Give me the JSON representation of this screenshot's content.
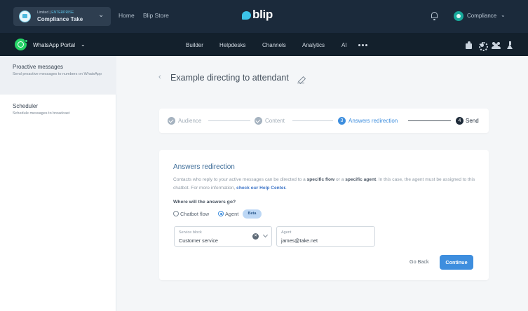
{
  "topbar": {
    "org_tier_prefix": "Limited | ",
    "org_tier_highlight": "ENTERPRISE",
    "org_name": "Compliance Take",
    "nav_home": "Home",
    "nav_store": "Blip Store",
    "brand": "blip",
    "account_name": "Compliance"
  },
  "subbar": {
    "portal_name": "WhatsApp Portal",
    "tabs": [
      "Builder",
      "Helpdesks",
      "Channels",
      "Analytics",
      "AI"
    ]
  },
  "sidebar": {
    "items": [
      {
        "title": "Proactive messages",
        "desc": "Send proactive messages to numbers on WhatsApp"
      },
      {
        "title": "Scheduler",
        "desc": "Schedule messages to broadcast"
      }
    ]
  },
  "main": {
    "page_title": "Example directing to attendant",
    "steps": [
      {
        "label": "Audience",
        "state": "done"
      },
      {
        "label": "Content",
        "state": "done"
      },
      {
        "num": "3",
        "label": "Answers redirection",
        "state": "current"
      },
      {
        "num": "4",
        "label": "Send",
        "state": "todo"
      }
    ],
    "section_title": "Answers redirection",
    "desc_1": "Contacts who reply to your active messages can be directed to a ",
    "desc_b1": "specific flow",
    "desc_2": " or a ",
    "desc_b2": "specific agent",
    "desc_3": ". In this case, the agent must be assigned to this chatbot. For more information, ",
    "desc_link": "check our Help Center.",
    "question": "Where will the answers go?",
    "radio_chatbot": "Chatbot flow",
    "radio_agent": "Agent",
    "selected_option": "Agent",
    "beta": "Beta",
    "field_service_label": "Service block",
    "field_service_value": "Customer service",
    "field_agent_label": "Agent",
    "field_agent_value": "james@take.net",
    "btn_back": "Go Back",
    "btn_continue": "Continue"
  },
  "colors": {
    "topbar_bg": "#1b2a3b",
    "subbar_bg": "#13202c",
    "accent": "#3e8ede",
    "whatsapp": "#25d366",
    "brand_bubble": "#3cc3e8"
  }
}
